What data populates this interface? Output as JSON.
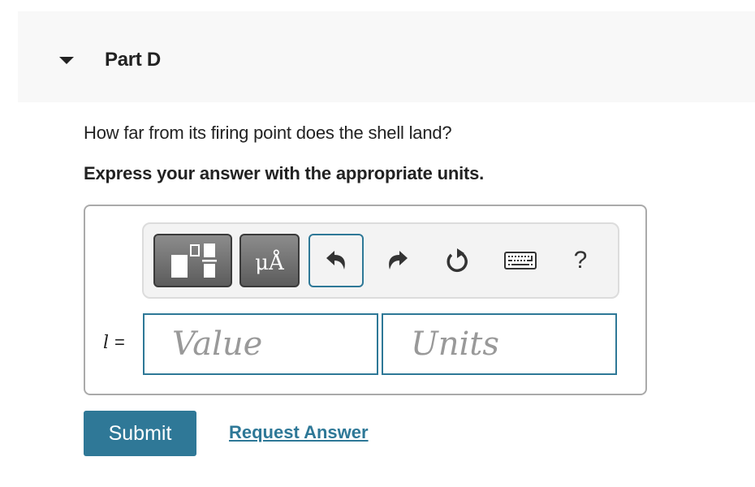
{
  "part": {
    "title": "Part D",
    "expanded": true
  },
  "question": "How far from its firing point does the shell land?",
  "instruction": "Express your answer with the appropriate units.",
  "toolbar": {
    "buttons": [
      {
        "name": "templates",
        "icon": "templates-icon"
      },
      {
        "name": "units",
        "icon": "units-icon",
        "label": "μÅ"
      },
      {
        "name": "undo",
        "icon": "undo-icon"
      },
      {
        "name": "redo",
        "icon": "redo-icon"
      },
      {
        "name": "reset",
        "icon": "reset-icon"
      },
      {
        "name": "keyboard",
        "icon": "keyboard-icon"
      },
      {
        "name": "help",
        "icon": "help-icon",
        "label": "?"
      }
    ]
  },
  "answer": {
    "variable": "l",
    "equals": "=",
    "value": "",
    "value_placeholder": "Value",
    "units": "",
    "units_placeholder": "Units"
  },
  "actions": {
    "submit_label": "Submit",
    "request_answer_label": "Request Answer"
  },
  "colors": {
    "accent": "#2f7897",
    "header_bg": "#f8f8f8",
    "toolbar_bg": "#f3f3f3"
  }
}
